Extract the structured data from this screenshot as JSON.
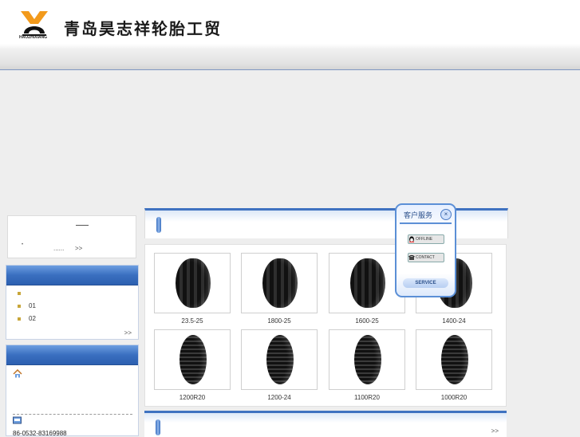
{
  "header": {
    "logo_text": "HAOZHIXIANG",
    "company_name": "青岛昊志祥轮胎工贸"
  },
  "news": {
    "bullet": "•",
    "dots": "......",
    "more": ">>"
  },
  "categories": {
    "items": [
      "",
      "01",
      "02"
    ],
    "more": ">>"
  },
  "contact": {
    "phone": "86-0532-83169988"
  },
  "products": [
    {
      "caption": "23.5-25"
    },
    {
      "caption": "1800-25"
    },
    {
      "caption": "1600-25"
    },
    {
      "caption": "1400-24"
    },
    {
      "caption": "1200R20"
    },
    {
      "caption": "1200-24"
    },
    {
      "caption": "1100R20"
    },
    {
      "caption": "1000R20"
    }
  ],
  "section2": {
    "more": ">>"
  },
  "customer_service": {
    "title": "客户服务",
    "close": "×",
    "offline_label": "OFFLINE",
    "contact_label": "CONTACT",
    "service_label": "SERVICE"
  }
}
